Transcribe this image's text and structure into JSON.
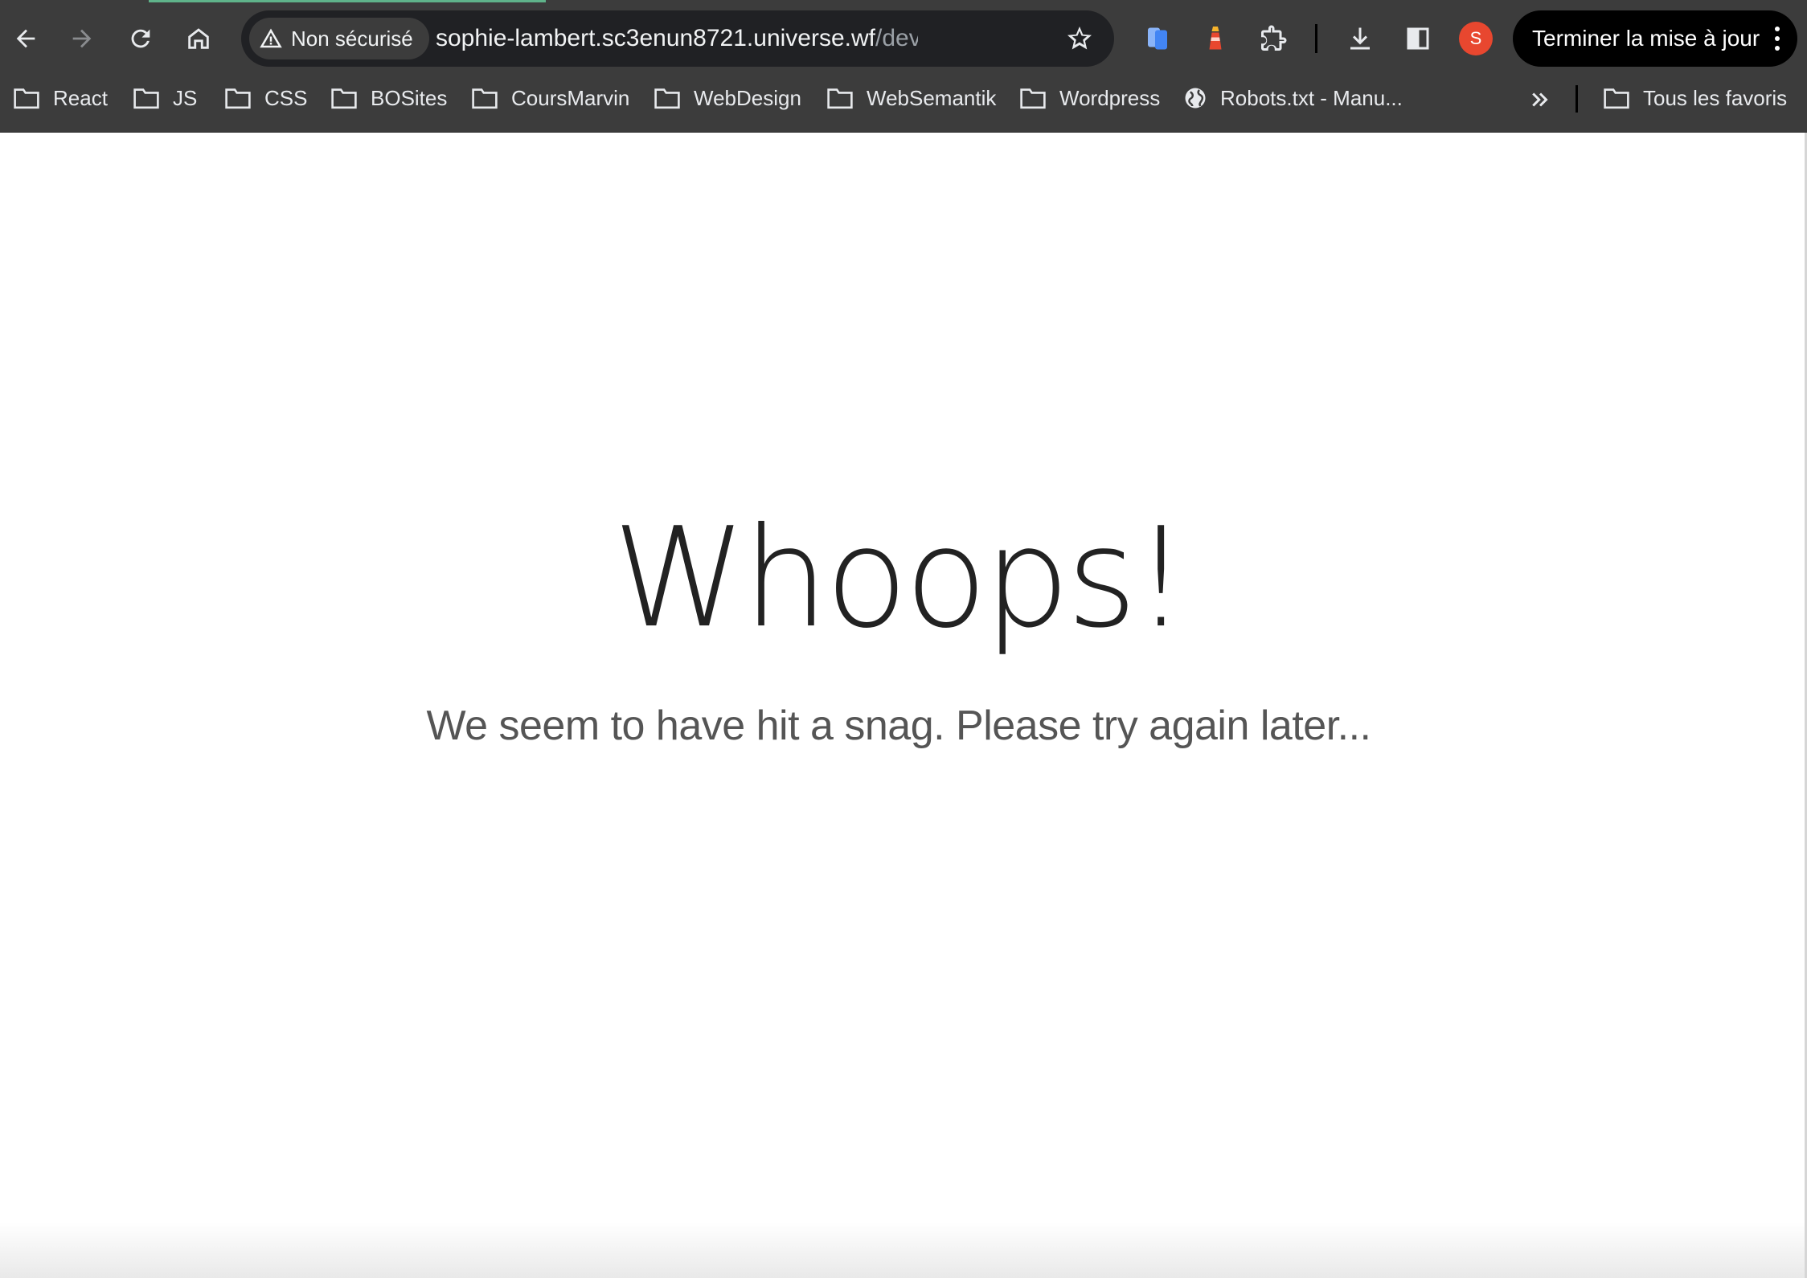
{
  "browser": {
    "nav": {
      "back_icon": "arrow-left-icon",
      "forward_icon": "arrow-right-icon",
      "reload_icon": "reload-icon",
      "home_icon": "home-icon"
    },
    "omnibox": {
      "security_icon": "warning-triangle-icon",
      "security_label": "Non sécurisé",
      "url_host": "sophie-lambert.sc3enun8721.universe.wf",
      "url_path": "/devis_php_co...",
      "bookmark_star_icon": "star-outline-icon"
    },
    "extensions": [
      "blue-phone-extension-icon",
      "lighthouse-extension-icon",
      "puzzle-extensions-icon"
    ],
    "actions": [
      "download-icon",
      "side-panel-icon"
    ],
    "profile_initial": "S",
    "profile_color": "#e8472f",
    "update_button_label": "Terminer la mise à jour"
  },
  "bookmarks": {
    "items": [
      {
        "label": "React",
        "icon": "folder-icon"
      },
      {
        "label": "JS",
        "icon": "folder-icon"
      },
      {
        "label": "CSS",
        "icon": "folder-icon"
      },
      {
        "label": "BOSites",
        "icon": "folder-icon"
      },
      {
        "label": "CoursMarvin",
        "icon": "folder-icon"
      },
      {
        "label": "WebDesign",
        "icon": "folder-icon"
      },
      {
        "label": "WebSemantik",
        "icon": "folder-icon"
      },
      {
        "label": "Wordpress",
        "icon": "folder-icon"
      },
      {
        "label": "Robots.txt - Manu...",
        "icon": "globe-icon"
      }
    ],
    "more_icon": "double-chevron-right-icon",
    "all_bookmarks_label": "Tous les favoris"
  },
  "page": {
    "title": "Whoops!",
    "message": "We seem to have hit a snag. Please try again later..."
  },
  "colors": {
    "toolbar_bg": "#3c3c3c",
    "omnibox_bg": "#202124",
    "loading_bar": "#5fb38a",
    "title_text": "#222222",
    "message_text": "#555555"
  }
}
